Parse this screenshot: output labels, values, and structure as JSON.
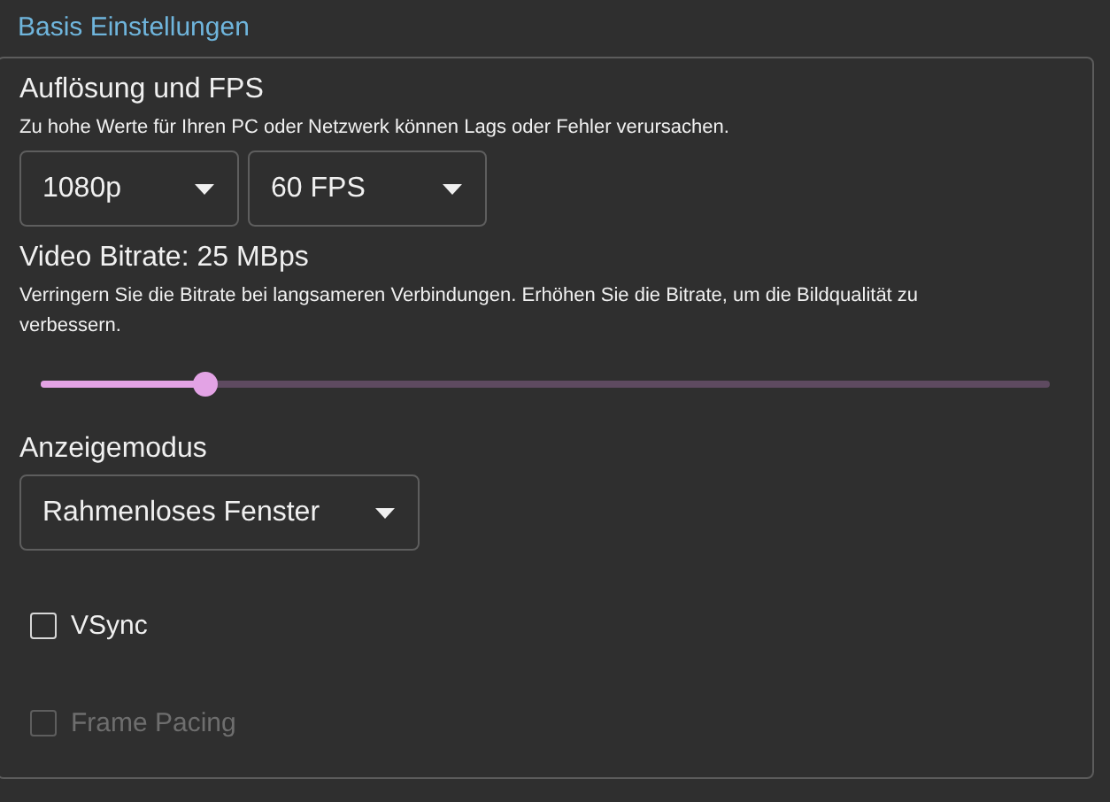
{
  "section_title": "Basis Einstellungen",
  "resolution_fps": {
    "heading": "Auflösung und FPS",
    "hint": "Zu hohe Werte für Ihren PC oder Netzwerk können Lags oder Fehler verursachen.",
    "dropdowns": [
      {
        "value": "1080p"
      },
      {
        "value": "60 FPS"
      }
    ]
  },
  "bitrate": {
    "heading": "Video Bitrate: 25 MBps",
    "hint": "Verringern Sie die Bitrate bei langsameren Verbindungen. Erhöhen Sie die Bitrate, um die Bildqualität zu verbessern.",
    "slider": {
      "level": 0.163
    }
  },
  "display_mode": {
    "heading": "Anzeigemodus",
    "dropdown": {
      "value": "Rahmenloses Fenster"
    }
  },
  "checkboxes": [
    {
      "label": "VSync",
      "checked": false,
      "disabled": false
    },
    {
      "label": "Frame Pacing",
      "checked": false,
      "disabled": true
    }
  ]
}
